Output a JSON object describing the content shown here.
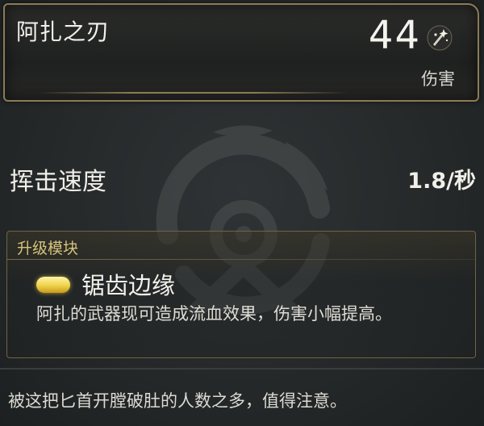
{
  "item": {
    "name": "阿扎之刃",
    "damage_value": "44",
    "damage_label": "伤害",
    "damage_icon": "sparkle-slash-icon"
  },
  "stats": {
    "swing_speed_label": "挥击速度",
    "swing_speed_value": "1.8/秒"
  },
  "upgrade_module": {
    "header": "升级模块",
    "icon": "capsule-icon",
    "name": "锯齿边缘",
    "description": "阿扎的武器现可造成流血效果，伤害小幅提高。"
  },
  "flavor_text": "被这把匕首开膛破肚的人数之多，值得注意。",
  "colors": {
    "accent_gold": "#8c7b55",
    "module_header": "#d6c37a",
    "capsule": "#f0d24a"
  }
}
